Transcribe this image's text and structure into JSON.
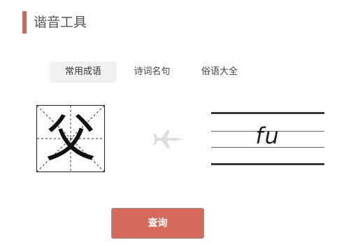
{
  "header": {
    "title": "谐音工具"
  },
  "tabs": [
    {
      "label": "常用成语",
      "active": true
    },
    {
      "label": "诗词名句",
      "active": false
    },
    {
      "label": "俗语大全",
      "active": false
    }
  ],
  "converter": {
    "character": "父",
    "pinyin": "fu",
    "arrow_icon": "airplane-icon"
  },
  "query_button": {
    "label": "查询"
  },
  "colors": {
    "accent": "#c96a5c",
    "button": "#d5695a",
    "tab_active_bg": "#f1f1f1"
  }
}
